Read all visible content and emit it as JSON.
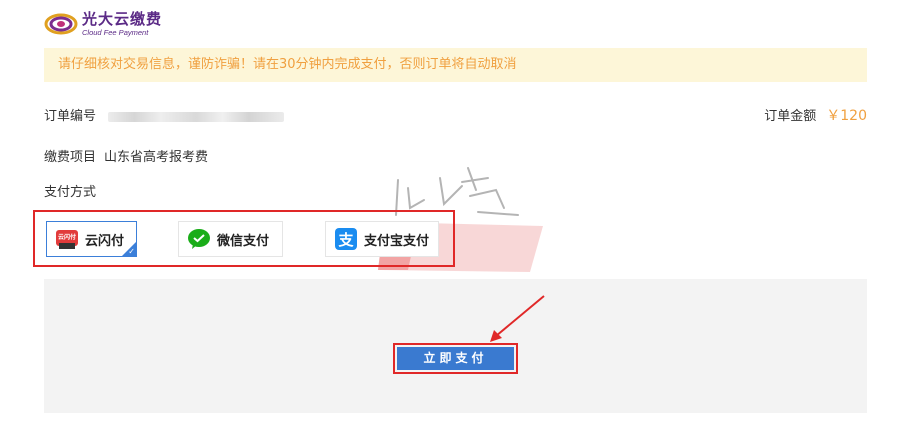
{
  "header": {
    "logo_cn": "光大云缴费",
    "logo_en": "Cloud Fee Payment"
  },
  "notice": {
    "text": "请仔细核对交易信息，谨防诈骗！请在30分钟内完成支付，否则订单将自动取消"
  },
  "order": {
    "number_label": "订单编号",
    "amount_label": "订单金额",
    "amount_value": "￥120",
    "item_label": "缴费项目",
    "item_value": "山东省高考报考费",
    "method_label": "支付方式"
  },
  "payment_methods": [
    {
      "label": "云闪付",
      "icon": "unionpay-quickpass-icon",
      "selected": true
    },
    {
      "label": "微信支付",
      "icon": "wechat-pay-icon",
      "selected": false
    },
    {
      "label": "支付宝支付",
      "icon": "alipay-icon",
      "selected": false
    }
  ],
  "actions": {
    "pay_now": "立即支付"
  },
  "watermark": {
    "text": "山东升学"
  },
  "colors": {
    "brand": "#5b2a86",
    "warning_bg": "#fdf6d8",
    "warning_text": "#f0a040",
    "selected_border": "#3b7fd9",
    "pay_button": "#3a7ad0",
    "highlight_red": "#e02828"
  }
}
